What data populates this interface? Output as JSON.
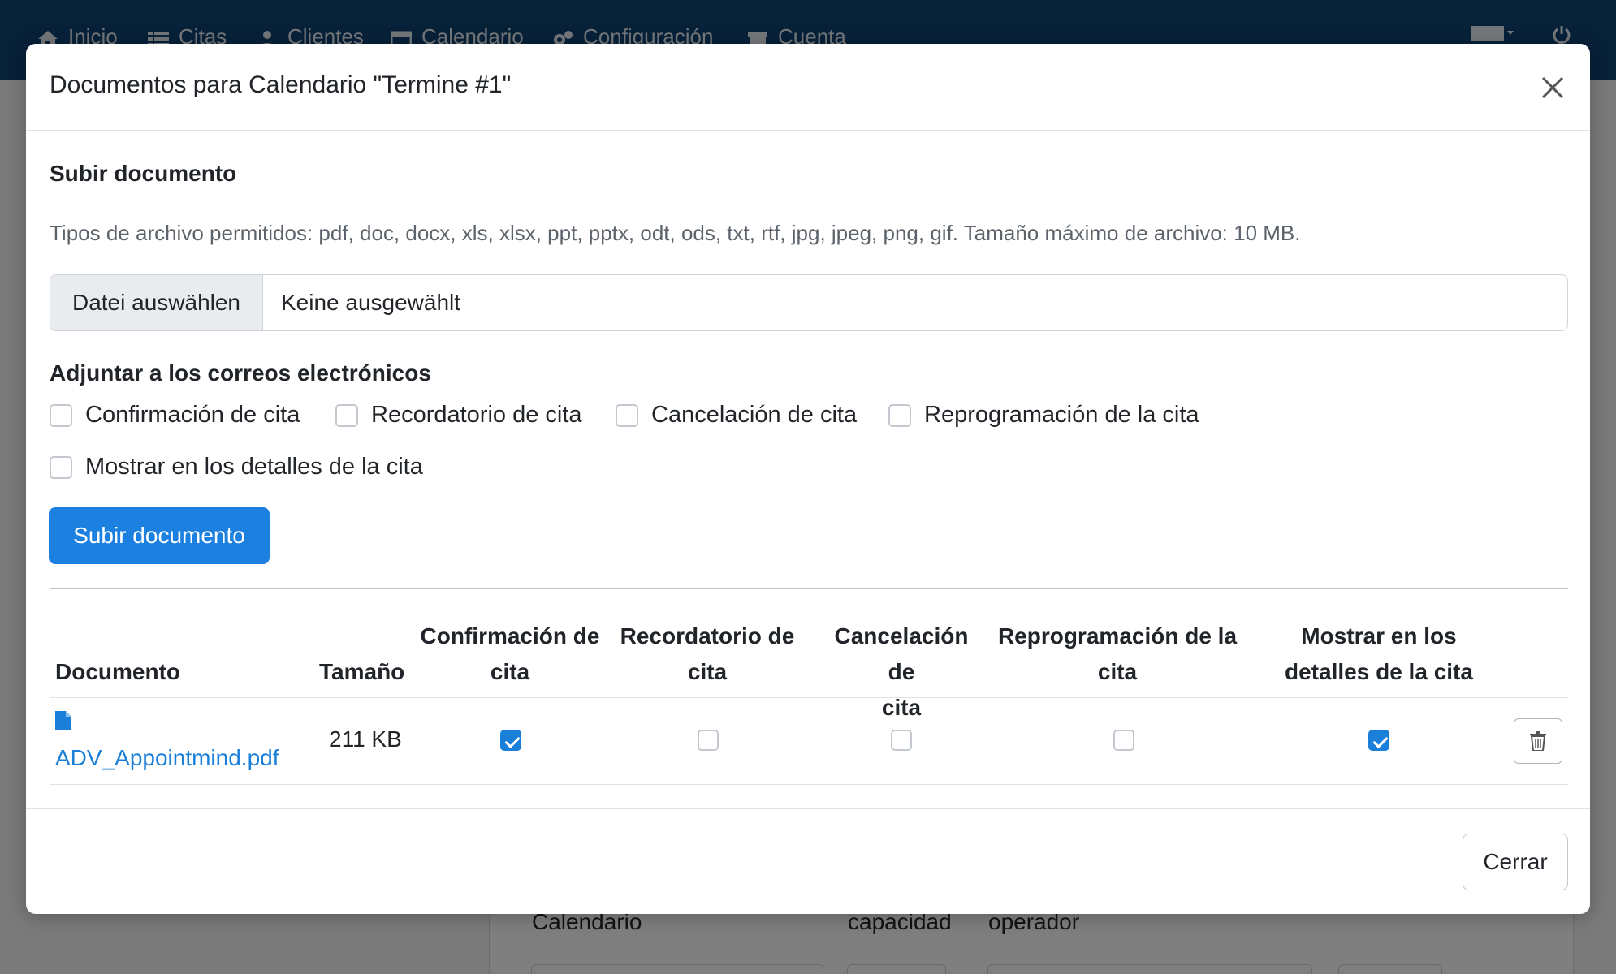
{
  "navbar": {
    "items": [
      {
        "label": "Inicio",
        "icon": "home-icon"
      },
      {
        "label": "Citas",
        "icon": "list-icon"
      },
      {
        "label": "Clientes",
        "icon": "user-icon"
      },
      {
        "label": "Calendario",
        "icon": "calendar-icon"
      },
      {
        "label": "Configuración",
        "icon": "gears-icon"
      },
      {
        "label": "Cuenta",
        "icon": "archive-icon"
      }
    ],
    "language_icon": "language-icon",
    "power_icon": "power-icon"
  },
  "background": {
    "columns": [
      "Calendario",
      "capacidad",
      "operador"
    ]
  },
  "modal": {
    "title": "Documentos para Calendario \"Termine #1\"",
    "upload_section_title": "Subir documento",
    "help_text": "Tipos de archivo permitidos: pdf, doc, docx, xls, xlsx, ppt, pptx, odt, ods, txt, rtf, jpg, jpeg, png, gif. Tamaño máximo de archivo: 10 MB.",
    "file_button": "Datei auswählen",
    "file_status": "Keine ausgewählt",
    "attach_title": "Adjuntar a los correos electrónicos",
    "checkboxes": [
      {
        "label": "Confirmación de cita",
        "checked": false
      },
      {
        "label": "Recordatorio de cita",
        "checked": false
      },
      {
        "label": "Cancelación de cita",
        "checked": false
      },
      {
        "label": "Reprogramación de la cita",
        "checked": false
      }
    ],
    "show_in_details": {
      "label": "Mostrar en los detalles de la cita",
      "checked": false
    },
    "upload_button": "Subir documento",
    "table": {
      "headers": {
        "document": "Documento",
        "size": "Tamaño",
        "confirm": [
          "Confirmación de",
          "cita"
        ],
        "reminder": [
          "Recordatorio de",
          "cita"
        ],
        "cancel": [
          "Cancelación de",
          "cita"
        ],
        "reschedule": [
          "Reprogramación de la",
          "cita"
        ],
        "details": [
          "Mostrar en los",
          "detalles de la cita"
        ]
      },
      "rows": [
        {
          "name": "ADV_Appointmind.pdf",
          "size": "211 KB",
          "confirm": true,
          "reminder": false,
          "cancel": false,
          "reschedule": false,
          "details": true
        }
      ]
    },
    "footer_close": "Cerrar"
  },
  "colors": {
    "navbar": "#0f4373",
    "primary": "#1c80e0",
    "link": "#1a7fd9"
  }
}
